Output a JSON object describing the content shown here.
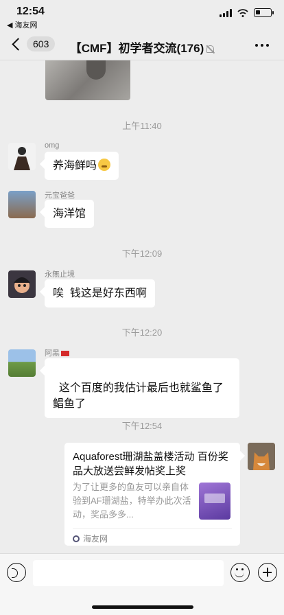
{
  "status_bar": {
    "time": "12:54",
    "back_app": "◀ 海友网"
  },
  "nav": {
    "back_count": "603",
    "title": "【CMF】初学者交流(176)"
  },
  "messages": [
    {
      "timestamp": "上午11:40",
      "sender": "omg",
      "text": "养海鲜吗"
    },
    {
      "sender": "元宝爸爸",
      "text": "海洋馆"
    },
    {
      "timestamp": "下午12:09",
      "sender": "永無止境",
      "text": "唉  钱这是好东西啊"
    },
    {
      "timestamp": "下午12:20",
      "sender": "阿黑",
      "text": "这个百度的我估计最后也就鲨鱼了\n鲳鱼了"
    },
    {
      "timestamp": "下午12:54"
    }
  ],
  "link_card": {
    "title": "Aquaforest珊湖盐盖楼活动 百份奖品大放送尝鲜发帖奖上奖",
    "description": "为了让更多的鱼友可以亲自体验到AF珊湖盐，特举办此次活动，奖品多多...",
    "source": "海友网"
  }
}
